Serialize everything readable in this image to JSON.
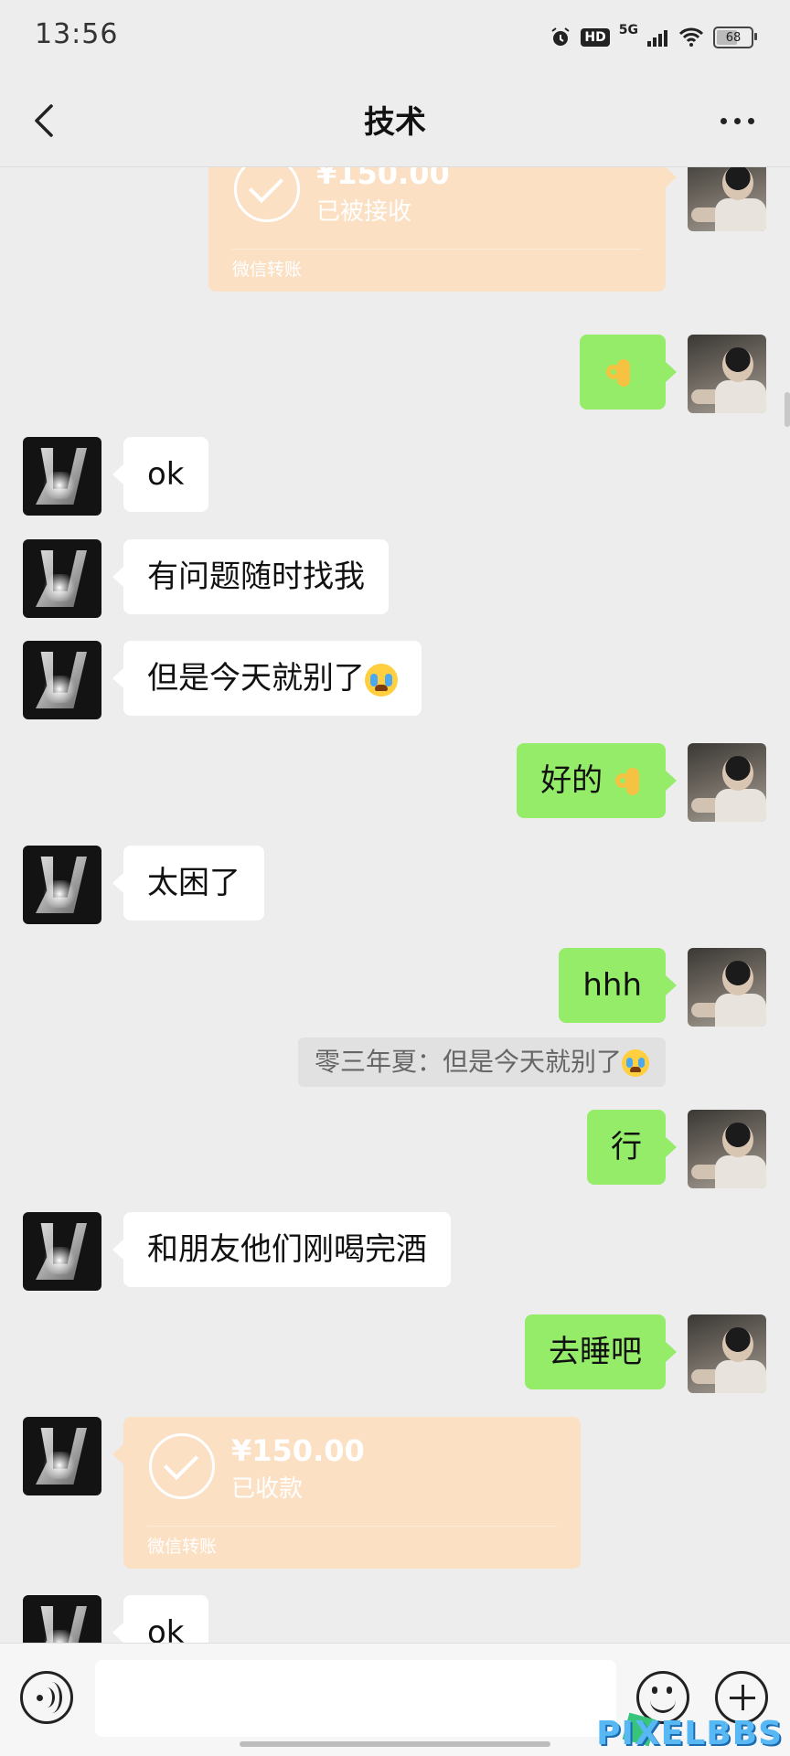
{
  "status_bar": {
    "time": "13:56",
    "network": "5G",
    "hd": "HD",
    "battery": "68"
  },
  "header": {
    "title": "技术"
  },
  "transfer_top": {
    "amount": "¥150.00",
    "status": "已被接收",
    "footer": "微信转账"
  },
  "messages": {
    "m1_ok": "ok",
    "m2": "有问题随时找我",
    "m3": "但是今天就别了",
    "m4": "好的",
    "m5": "太困了",
    "m6": "hhh",
    "quote": "零三年夏：但是今天就别了",
    "m7": "行",
    "m8": "和朋友他们刚喝完酒",
    "m9": "去睡吧",
    "m10_ok": "ok"
  },
  "transfer_bottom": {
    "amount": "¥150.00",
    "status": "已收款",
    "footer": "微信转账"
  },
  "input": {
    "placeholder": ""
  },
  "watermark": "PIXELBBS",
  "colors": {
    "chat_bg": "#ededed",
    "sent_bubble": "#95ec69",
    "received_bubble": "#ffffff",
    "transfer_card": "#fbe0c4"
  }
}
